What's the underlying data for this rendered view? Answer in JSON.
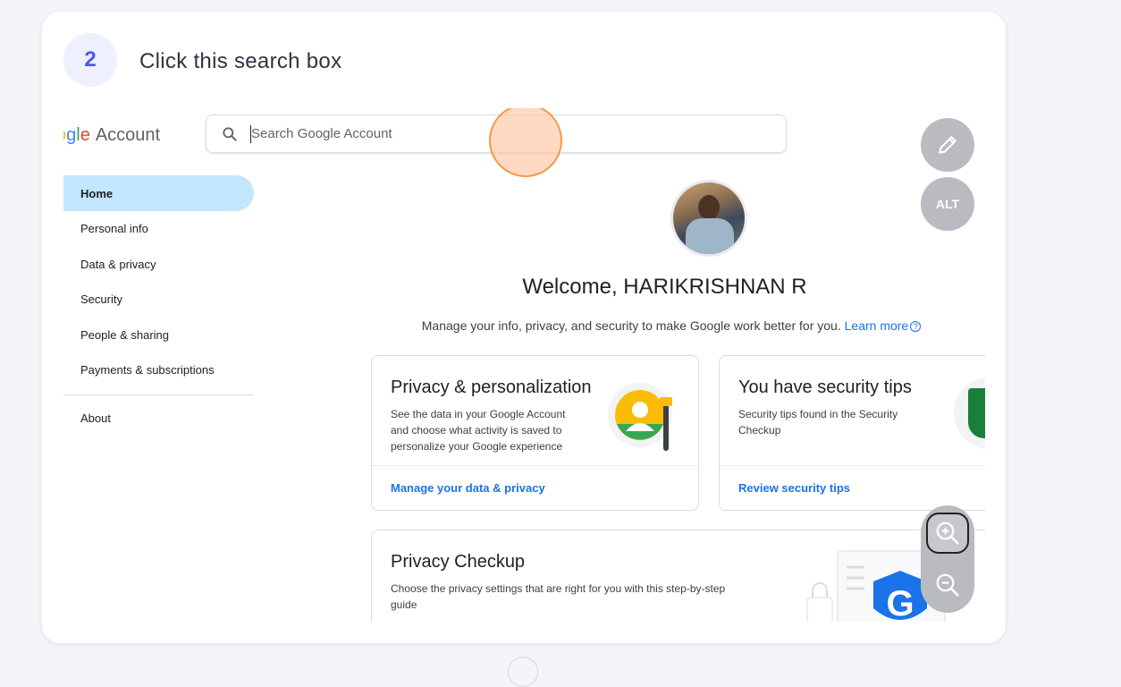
{
  "step": {
    "number": "2",
    "instruction": "Click this search box"
  },
  "screenshot": {
    "logo": {
      "partial": "oogle",
      "account": "Account"
    },
    "search": {
      "placeholder": "Search Google Account"
    },
    "sidebar": {
      "items": [
        {
          "label": "Home",
          "active": true
        },
        {
          "label": "Personal info"
        },
        {
          "label": "Data & privacy"
        },
        {
          "label": "Security"
        },
        {
          "label": "People & sharing"
        },
        {
          "label": "Payments & subscriptions"
        },
        {
          "label": "About"
        }
      ]
    },
    "welcome": "Welcome, HARIKRISHNAN R",
    "subtitle": "Manage your info, privacy, and security to make Google work better for you.",
    "learn_more": "Learn more",
    "cards": {
      "privacy": {
        "title": "Privacy & personalization",
        "desc_line1": "See the data in your Google Account",
        "desc_line2": "and choose what activity is saved to",
        "desc_line3": "personalize your Google experience",
        "link": "Manage your data & privacy"
      },
      "security": {
        "title": "You have security tips",
        "desc_line1": "Security tips found in the Security",
        "desc_line2": "Checkup",
        "link": "Review security tips"
      },
      "checkup": {
        "title": "Privacy Checkup",
        "desc_line1": "Choose the privacy settings that are right for you with this step-by-step",
        "desc_line2": "guide"
      }
    }
  },
  "controls": {
    "edit_icon": "pencil-icon",
    "alt_label": "ALT",
    "zoom_in_icon": "zoom-in-icon",
    "zoom_out_icon": "zoom-out-icon"
  },
  "colors": {
    "accent": "#4a5ae6",
    "highlight": "#f39a4c",
    "google_blue": "#1a73e8",
    "nav_active": "#c2e7ff"
  }
}
